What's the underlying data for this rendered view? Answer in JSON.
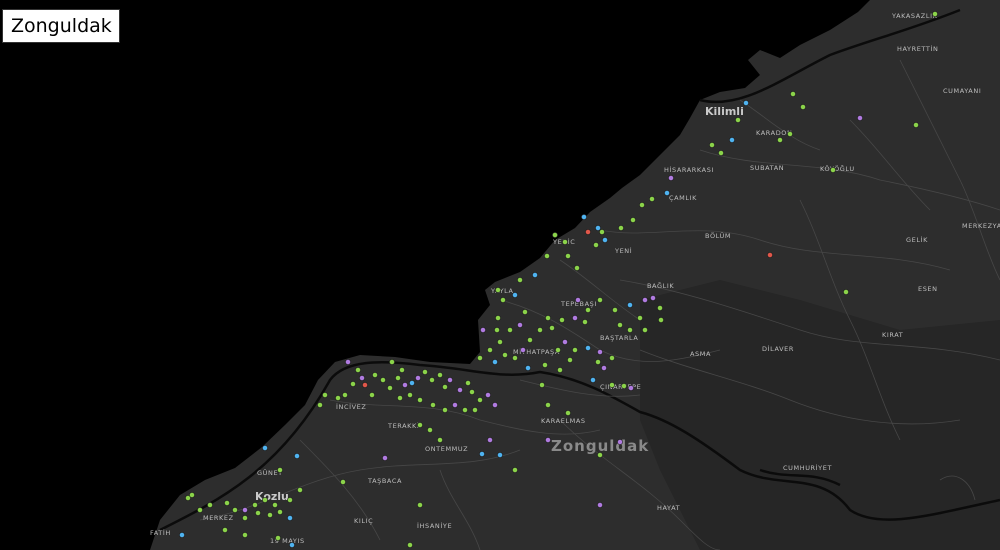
{
  "map": {
    "title": "Zonguldak",
    "colors": {
      "background": "#000000",
      "land": "#2d2d2d",
      "roads_major": "#0b0b0b",
      "roads_minor": "#4a4a4a",
      "label": "#bdbdbd",
      "poi_green": "#8bd34a",
      "poi_purple": "#b07be0",
      "poi_blue": "#4fb3f0",
      "poi_red": "#e0574a"
    },
    "labels": {
      "city": "Zonguldak",
      "kilimli": "Kilimli",
      "kozlu": "Kozlu",
      "yakasazlik": "YAKASAZLIK",
      "hayrettin": "HAYRETTİN",
      "cumayani": "CUMAYANI",
      "karadon": "KARADON",
      "hisararkasi": "HİSARARKASI",
      "subatan": "SUBATAN",
      "kocaoglu": "KÖYÖĞLU",
      "camlik": "ÇAMLIK",
      "bolum": "BÖLÜM",
      "gelik": "GELİK",
      "merkezyaka": "MERKEZYA",
      "yeni": "YENİ",
      "baglik": "BAĞLIK",
      "esen": "ESEN",
      "tepebasi": "TEPEBAŞI",
      "bastarla": "BAŞTARLA",
      "kirat": "KIRAT",
      "mithatpasa": "MİTHATPAŞA",
      "asma": "ASMA",
      "dilaver": "DİLAVER",
      "cinartepe": "ÇINARTEPE",
      "incivez": "İNCİVEZ",
      "terakki": "TERAKKİ",
      "karaelmas": "KARAELMAS",
      "ontemmuz": "ONTEMMUZ",
      "guney": "GÜNEY",
      "tasbaca": "TAŞBACA",
      "cumhuriyet": "CUMHURİYET",
      "hayat": "HAYAT",
      "merkez": "MERKEZ",
      "kilic": "KILIÇ",
      "ihsaniye": "İHSANİYE",
      "fatih": "FATİH",
      "ondokuzmayis": "19 MAYIS",
      "yayla": "YAYLA",
      "yenic": "YENİC"
    },
    "poi_categories": [
      "green",
      "purple",
      "blue",
      "red"
    ]
  }
}
